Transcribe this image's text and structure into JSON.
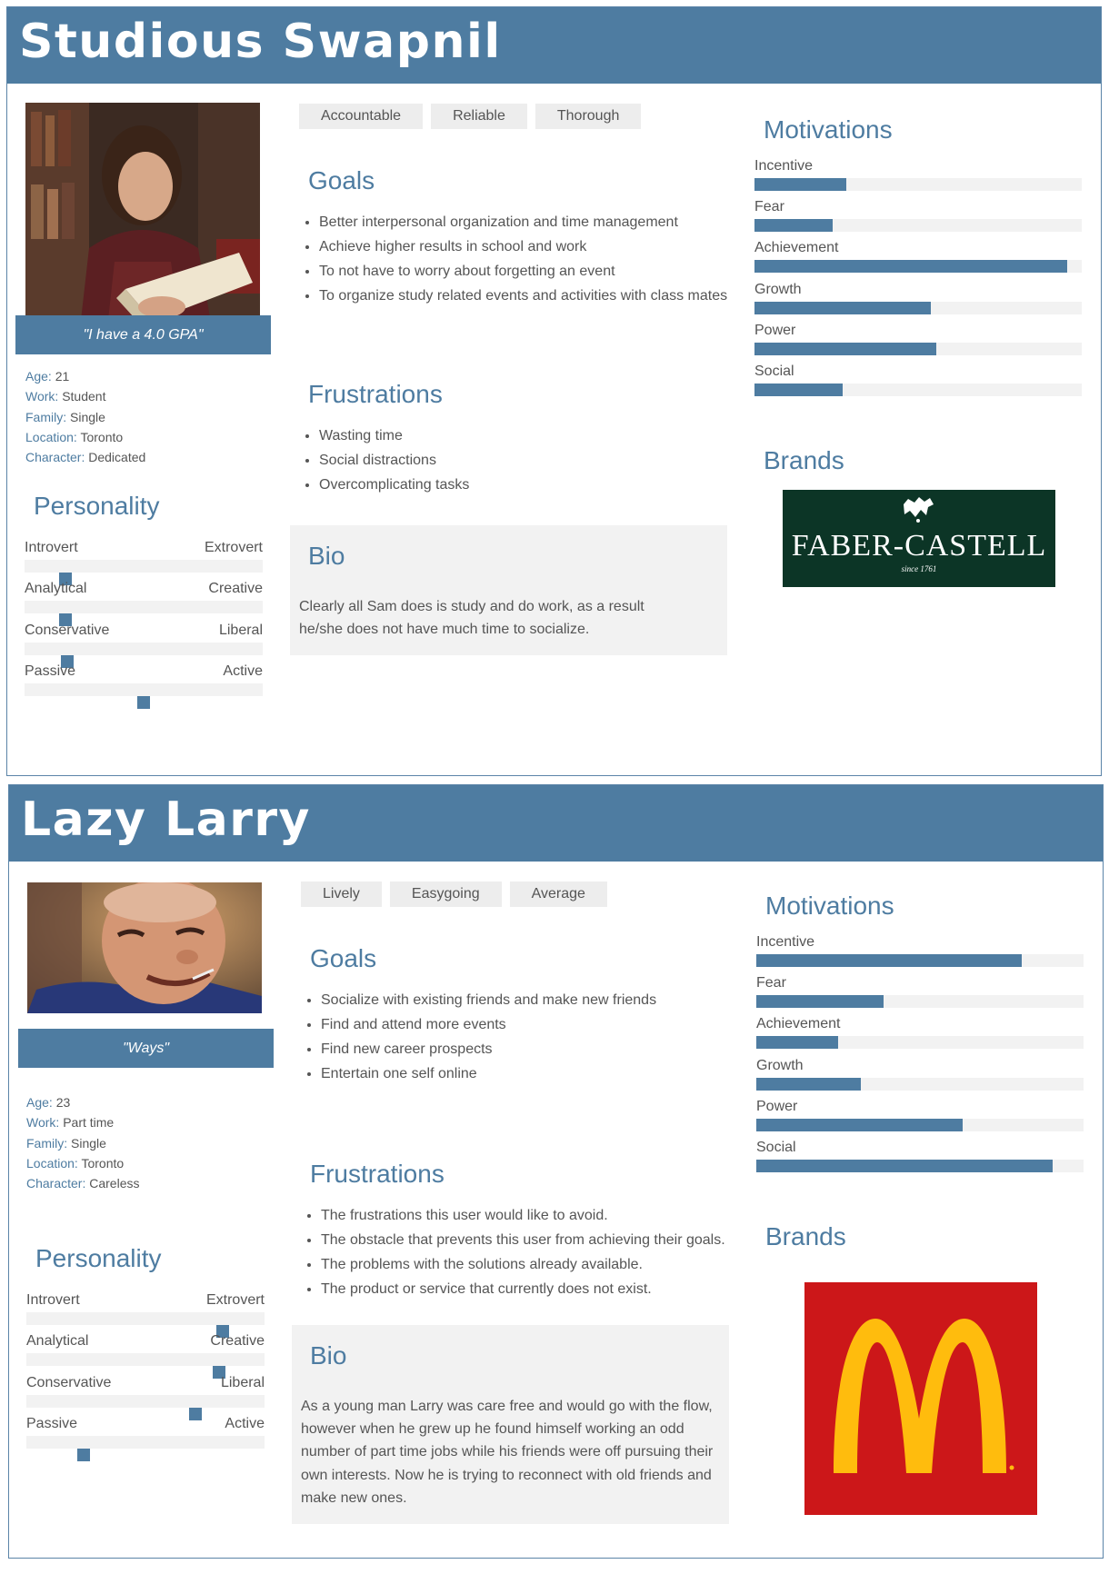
{
  "personas": [
    {
      "name": "Studious Swapnil",
      "quote": "\"I have a 4.0 GPA\"",
      "facts": [
        {
          "key": "Age:",
          "value": "21"
        },
        {
          "key": "Work:",
          "value": "Student"
        },
        {
          "key": "Family:",
          "value": "Single"
        },
        {
          "key": "Location:",
          "value": "Toronto"
        },
        {
          "key": "Character:",
          "value": "Dedicated"
        }
      ],
      "personality_title": "Personality",
      "personality": [
        {
          "left": "Introvert",
          "right": "Extrovert",
          "level": 0.17
        },
        {
          "left": "Analytical",
          "right": "Creative",
          "level": 0.17
        },
        {
          "left": "Conservative",
          "right": "Liberal",
          "level": 0.18
        },
        {
          "left": "Passive",
          "right": "Active",
          "level": 0.5
        }
      ],
      "tags": [
        "Accountable",
        "Reliable",
        "Thorough"
      ],
      "goals_title": "Goals",
      "goals": [
        "Better interpersonal organization and time management",
        "Achieve higher results in school and work",
        "To not have to worry about forgetting an event",
        "To organize study related events and activities with class mates"
      ],
      "frustrations_title": "Frustrations",
      "frustrations": [
        "Wasting time",
        "Social distractions",
        "Overcomplicating tasks"
      ],
      "bio_title": "Bio",
      "bio": "Clearly all Sam does is study and do work, as a result he/she does not have much time to socialize.",
      "motivations_title": "Motivations",
      "motivations": [
        {
          "label": "Incentive",
          "level": 0.28
        },
        {
          "label": "Fear",
          "level": 0.24
        },
        {
          "label": "Achievement",
          "level": 0.955
        },
        {
          "label": "Growth",
          "level": 0.54
        },
        {
          "label": "Power",
          "level": 0.555
        },
        {
          "label": "Social",
          "level": 0.27
        }
      ],
      "brands_title": "Brands",
      "brand": {
        "name": "FABER-CASTELL",
        "tagline": "since 1761",
        "icon": "faber-castell-logo"
      },
      "photo_icon": "man-reading-book-photo",
      "colors": {
        "accent": "#4e7ca1",
        "track": "#f2f2f2"
      }
    },
    {
      "name": "Lazy Larry",
      "quote": "\"Ways\"",
      "facts": [
        {
          "key": "Age:",
          "value": "23"
        },
        {
          "key": "Work:",
          "value": "Part time"
        },
        {
          "key": "Family:",
          "value": "Single"
        },
        {
          "key": "Location:",
          "value": "Toronto"
        },
        {
          "key": "Character:",
          "value": "Careless"
        }
      ],
      "personality_title": "Personality",
      "personality": [
        {
          "left": "Introvert",
          "right": "Extrovert",
          "level": 0.825
        },
        {
          "left": "Analytical",
          "right": "Creative",
          "level": 0.81
        },
        {
          "left": "Conservative",
          "right": "Liberal",
          "level": 0.71
        },
        {
          "left": "Passive",
          "right": "Active",
          "level": 0.24
        }
      ],
      "tags": [
        "Lively",
        "Easygoing",
        "Average"
      ],
      "goals_title": "Goals",
      "goals": [
        "Socialize with existing friends and make new friends",
        "Find and attend more events",
        "Find new career prospects",
        "Entertain one self online"
      ],
      "frustrations_title": "Frustrations",
      "frustrations": [
        "The frustrations this user would like to avoid.",
        "The obstacle that prevents this user from achieving their goals.",
        "The problems with the solutions already available.",
        "The product or service that currently does not exist."
      ],
      "bio_title": "Bio",
      "bio": "As a young man Larry was care free and would go with the flow, however when he grew up he found himself working an odd number of part time jobs while his friends were off pursuing their own interests. Now he is trying to reconnect with old friends and make new ones.",
      "motivations_title": "Motivations",
      "motivations": [
        {
          "label": "Incentive",
          "level": 0.81
        },
        {
          "label": "Fear",
          "level": 0.39
        },
        {
          "label": "Achievement",
          "level": 0.25
        },
        {
          "label": "Growth",
          "level": 0.32
        },
        {
          "label": "Power",
          "level": 0.63
        },
        {
          "label": "Social",
          "level": 0.905
        }
      ],
      "brands_title": "Brands",
      "brand": {
        "name": "",
        "tagline": "",
        "icon": "mcdonalds-logo"
      },
      "photo_icon": "smiling-man-photo",
      "colors": {
        "accent": "#4e7ca1",
        "track": "#f2f2f2",
        "brand_red": "#cc1719",
        "brand_yellow": "#ffbc0d"
      }
    }
  ]
}
